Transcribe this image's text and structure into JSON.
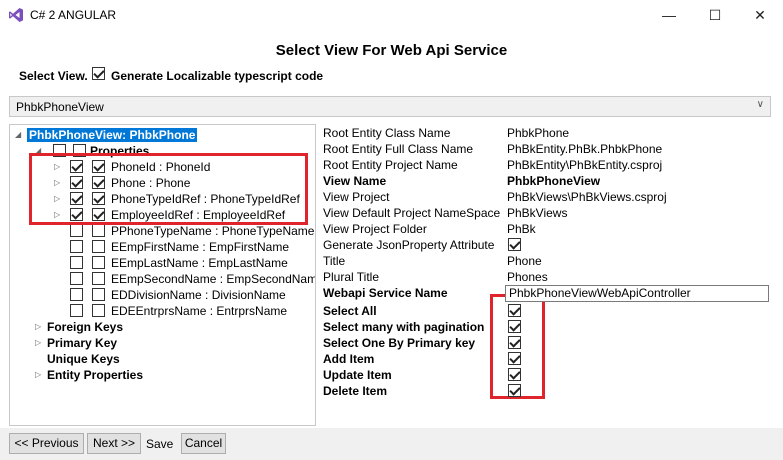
{
  "window": {
    "title": "C# 2 ANGULAR",
    "minimize": "—",
    "maximize": "☐",
    "close": "✕"
  },
  "heading": "Select View For Web Api Service",
  "select_view_label": "Select View.",
  "generate_localizable": {
    "label": "Generate Localizable typescript code",
    "checked": true
  },
  "dropdown": {
    "value": "PhbkPhoneView"
  },
  "tree": {
    "root": "PhbkPhoneView: PhbkPhone",
    "properties_label": "Properties",
    "properties": [
      {
        "label": "PhoneId : PhoneId",
        "checked1": true,
        "checked2": true
      },
      {
        "label": "Phone : Phone",
        "checked1": true,
        "checked2": true
      },
      {
        "label": "PhoneTypeIdRef : PhoneTypeIdRef",
        "checked1": true,
        "checked2": true
      },
      {
        "label": "EmployeeIdRef : EmployeeIdRef",
        "checked1": true,
        "checked2": true
      },
      {
        "label": "PPhoneTypeName : PhoneTypeName",
        "checked1": false,
        "checked2": false
      },
      {
        "label": "EEmpFirstName : EmpFirstName",
        "checked1": false,
        "checked2": false
      },
      {
        "label": "EEmpLastName : EmpLastName",
        "checked1": false,
        "checked2": false
      },
      {
        "label": "EEmpSecondName : EmpSecondName",
        "checked1": false,
        "checked2": false
      },
      {
        "label": "EDDivisionName : DivisionName",
        "checked1": false,
        "checked2": false
      },
      {
        "label": "EDEEntrprsName : EntrprsName",
        "checked1": false,
        "checked2": false
      }
    ],
    "foreign_keys": "Foreign Keys",
    "primary_key": "Primary Key",
    "unique_keys": "Unique Keys",
    "entity_properties": "Entity Properties"
  },
  "grid": {
    "root_entity_class_name": {
      "label": "Root Entity Class Name",
      "value": "PhbkPhone"
    },
    "root_entity_full_class_name": {
      "label": "Root Entity Full Class Name",
      "value": "PhBkEntity.PhBk.PhbkPhone"
    },
    "root_entity_project_name": {
      "label": "Root Entity Project Name",
      "value": "PhBkEntity\\PhBkEntity.csproj"
    },
    "view_name": {
      "label": "View Name",
      "value": "PhbkPhoneView"
    },
    "view_project": {
      "label": "View Project",
      "value": "PhBkViews\\PhBkViews.csproj"
    },
    "view_default_project_namespace": {
      "label": "View Default Project NameSpace",
      "value": "PhBkViews"
    },
    "view_project_folder": {
      "label": "View Project Folder",
      "value": "PhBk"
    },
    "generate_json_property_attribute": {
      "label": "Generate JsonProperty Attribute",
      "checked": true
    },
    "title": {
      "label": "Title",
      "value": "Phone"
    },
    "plural_title": {
      "label": "Plural Title",
      "value": "Phones"
    },
    "webapi_service_name": {
      "label": "Webapi Service Name",
      "value": "PhbkPhoneViewWebApiController"
    },
    "select_all": {
      "label": "Select All",
      "checked": true
    },
    "select_many_with_pagination": {
      "label": "Select many with pagination",
      "checked": true
    },
    "select_one_by_primary_key": {
      "label": "Select One By Primary key",
      "checked": true
    },
    "add_item": {
      "label": "Add Item",
      "checked": true
    },
    "update_item": {
      "label": "Update Item",
      "checked": true
    },
    "delete_item": {
      "label": "Delete Item",
      "checked": true
    }
  },
  "buttons": {
    "previous": "<< Previous",
    "next": "Next >>",
    "save": "Save",
    "cancel": "Cancel"
  },
  "colors": {
    "highlight": "#e0242b",
    "selection": "#0078d7",
    "vs_purple": "#7b4fbc"
  }
}
